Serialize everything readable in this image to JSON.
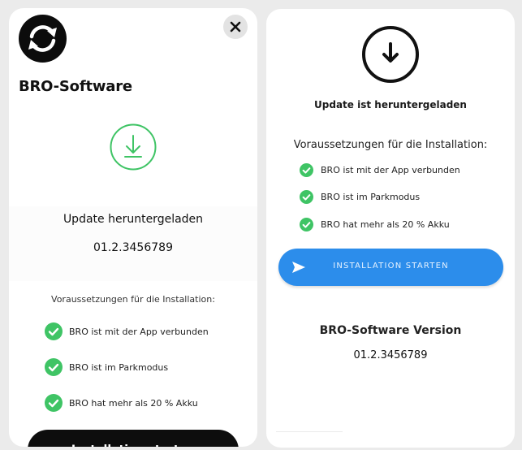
{
  "colors": {
    "background": "#ebebeb",
    "card": "#ffffff",
    "accent_green": "#3fc465",
    "primary_blue": "#2c8deb",
    "dark": "#0d0d0d"
  },
  "left_panel": {
    "logo_icon": "sync-icon",
    "close_icon": "close-icon",
    "brand_title": "BRO-Software",
    "status_icon": "download-icon",
    "status_title": "Update heruntergeladen",
    "version": "01.2.3456789",
    "prereq_title": "Voraussetzungen für die Installation:",
    "requirements": [
      {
        "text": "BRO ist mit der App verbunden",
        "icon": "check-circle-icon",
        "met": true
      },
      {
        "text": "BRO ist im Parkmodus",
        "icon": "check-circle-icon",
        "met": true
      },
      {
        "text": "BRO hat mehr als 20 % Akku",
        "icon": "check-circle-icon",
        "met": true
      }
    ],
    "start_button": "Installation starten"
  },
  "right_panel": {
    "status_icon": "download-icon",
    "status_title": "Update ist heruntergeladen",
    "prereq_title": "Voraussetzungen für die Installation:",
    "requirements": [
      {
        "text": "BRO ist mit der App verbunden",
        "icon": "check-circle-icon",
        "met": true
      },
      {
        "text": "BRO ist im Parkmodus",
        "icon": "check-circle-icon",
        "met": true
      },
      {
        "text": "BRO hat mehr als 20 % Akku",
        "icon": "check-circle-icon",
        "met": true
      }
    ],
    "start_button": {
      "label": "INSTALLATION STARTEN",
      "icon": "send-icon"
    },
    "version_label": "BRO-Software Version",
    "version_value": "01.2.3456789"
  }
}
